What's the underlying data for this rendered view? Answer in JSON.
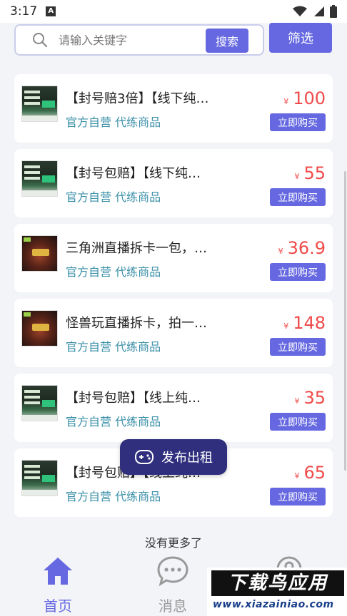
{
  "status_bar": {
    "time": "3:17",
    "notif_icon": "A"
  },
  "search": {
    "placeholder": "请输入关键字",
    "button_label": "搜索"
  },
  "filter": {
    "label": "筛选"
  },
  "listings": [
    {
      "title": "【封号赔3倍】【线下纯…",
      "subtitle": "官方自营 代练商品",
      "currency": "¥",
      "price": "100",
      "buy_label": "立即购买",
      "thumb": "a"
    },
    {
      "title": "【封号包赔】【线下纯…",
      "subtitle": "官方自营 代练商品",
      "currency": "¥",
      "price": "55",
      "buy_label": "立即购买",
      "thumb": "a"
    },
    {
      "title": "三角洲直播拆卡一包，…",
      "subtitle": "官方自营 代练商品",
      "currency": "¥",
      "price": "36.9",
      "buy_label": "立即购买",
      "thumb": "b"
    },
    {
      "title": "怪兽玩直播拆卡，拍一…",
      "subtitle": "官方自营 代练商品",
      "currency": "¥",
      "price": "148",
      "buy_label": "立即购买",
      "thumb": "b"
    },
    {
      "title": "【封号包赔】【线上纯…",
      "subtitle": "官方自营 代练商品",
      "currency": "¥",
      "price": "35",
      "buy_label": "立即购买",
      "thumb": "a"
    },
    {
      "title": "【封号包赔】【线上纯…",
      "subtitle": "官方自营 代练商品",
      "currency": "¥",
      "price": "65",
      "buy_label": "立即购买",
      "thumb": "a"
    }
  ],
  "no_more": "没有更多了",
  "fab": {
    "label": "发布出租",
    "icon": "gamepad-icon"
  },
  "tabbar": {
    "home_label": "首页",
    "messages_label": "消息"
  },
  "watermark": {
    "main": "下载鸟应用",
    "url": "www.xiazainiao.com"
  },
  "colors": {
    "accent": "#6568e0",
    "price": "#f04a4a",
    "subtitle": "#3a8fa8",
    "fab": "#2f2f7e"
  }
}
